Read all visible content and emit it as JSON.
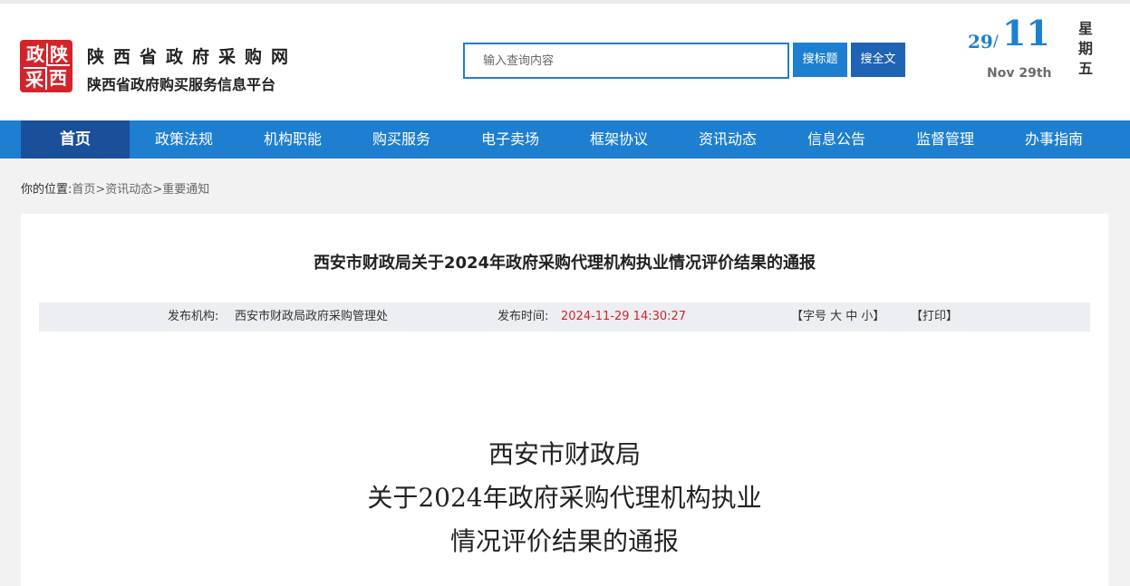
{
  "header": {
    "logo_chars": [
      "政",
      "陕",
      "采",
      "西"
    ],
    "site_name": "陕西省政府采购网",
    "site_subtitle": "陕西省政府购买服务信息平台",
    "accent_color": "#1e7fd0"
  },
  "search": {
    "placeholder": "输入查询内容",
    "value": "",
    "btn_title": "搜标题",
    "btn_full": "搜全文"
  },
  "date": {
    "day": "29",
    "slash": "/",
    "month": "11",
    "en": "Nov 29th",
    "weekday_chars": [
      "星",
      "期",
      "五"
    ]
  },
  "nav": {
    "items": [
      "首页",
      "政策法规",
      "机构职能",
      "购买服务",
      "电子卖场",
      "框架协议",
      "资讯动态",
      "信息公告",
      "监督管理",
      "办事指南"
    ],
    "active_index": 0
  },
  "breadcrumb": {
    "prefix": "你的位置:",
    "items": [
      "首页",
      ">资讯动态",
      ">重要通知"
    ]
  },
  "article": {
    "title": "西安市财政局关于2024年政府采购代理机构执业情况评价结果的通报",
    "publisher_label": "发布机构:",
    "publisher": "西安市财政局政府采购管理处",
    "time_label": "发布时间:",
    "time": "2024-11-29 14:30:27",
    "font_size_control": "【字号 大 中 小】",
    "print": "【打印】",
    "doc_title_lines": [
      "西安市财政局",
      "关于2024年政府采购代理机构执业",
      "情况评价结果的通报"
    ]
  }
}
